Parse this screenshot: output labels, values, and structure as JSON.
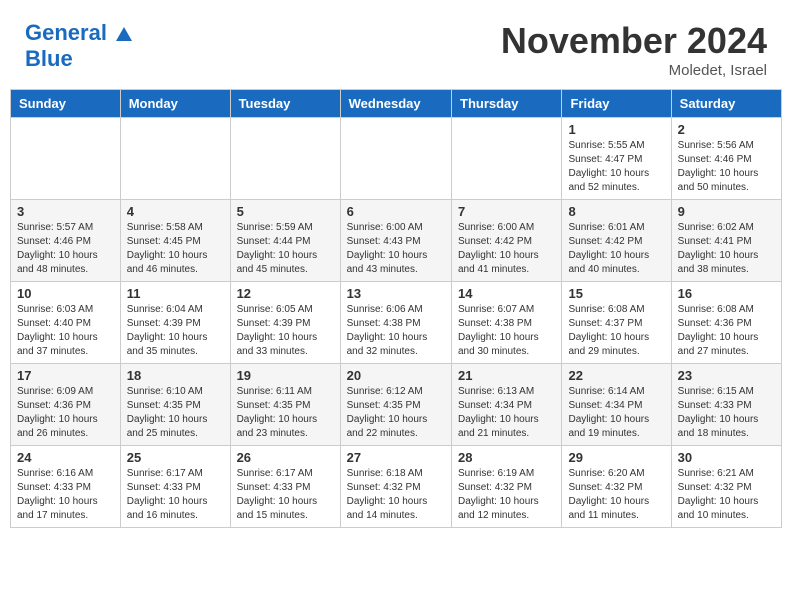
{
  "header": {
    "logo_line1": "General",
    "logo_line2": "Blue",
    "month": "November 2024",
    "location": "Moledet, Israel"
  },
  "weekdays": [
    "Sunday",
    "Monday",
    "Tuesday",
    "Wednesday",
    "Thursday",
    "Friday",
    "Saturday"
  ],
  "rows": [
    [
      {
        "day": "",
        "info": ""
      },
      {
        "day": "",
        "info": ""
      },
      {
        "day": "",
        "info": ""
      },
      {
        "day": "",
        "info": ""
      },
      {
        "day": "",
        "info": ""
      },
      {
        "day": "1",
        "info": "Sunrise: 5:55 AM\nSunset: 4:47 PM\nDaylight: 10 hours and 52 minutes."
      },
      {
        "day": "2",
        "info": "Sunrise: 5:56 AM\nSunset: 4:46 PM\nDaylight: 10 hours and 50 minutes."
      }
    ],
    [
      {
        "day": "3",
        "info": "Sunrise: 5:57 AM\nSunset: 4:46 PM\nDaylight: 10 hours and 48 minutes."
      },
      {
        "day": "4",
        "info": "Sunrise: 5:58 AM\nSunset: 4:45 PM\nDaylight: 10 hours and 46 minutes."
      },
      {
        "day": "5",
        "info": "Sunrise: 5:59 AM\nSunset: 4:44 PM\nDaylight: 10 hours and 45 minutes."
      },
      {
        "day": "6",
        "info": "Sunrise: 6:00 AM\nSunset: 4:43 PM\nDaylight: 10 hours and 43 minutes."
      },
      {
        "day": "7",
        "info": "Sunrise: 6:00 AM\nSunset: 4:42 PM\nDaylight: 10 hours and 41 minutes."
      },
      {
        "day": "8",
        "info": "Sunrise: 6:01 AM\nSunset: 4:42 PM\nDaylight: 10 hours and 40 minutes."
      },
      {
        "day": "9",
        "info": "Sunrise: 6:02 AM\nSunset: 4:41 PM\nDaylight: 10 hours and 38 minutes."
      }
    ],
    [
      {
        "day": "10",
        "info": "Sunrise: 6:03 AM\nSunset: 4:40 PM\nDaylight: 10 hours and 37 minutes."
      },
      {
        "day": "11",
        "info": "Sunrise: 6:04 AM\nSunset: 4:39 PM\nDaylight: 10 hours and 35 minutes."
      },
      {
        "day": "12",
        "info": "Sunrise: 6:05 AM\nSunset: 4:39 PM\nDaylight: 10 hours and 33 minutes."
      },
      {
        "day": "13",
        "info": "Sunrise: 6:06 AM\nSunset: 4:38 PM\nDaylight: 10 hours and 32 minutes."
      },
      {
        "day": "14",
        "info": "Sunrise: 6:07 AM\nSunset: 4:38 PM\nDaylight: 10 hours and 30 minutes."
      },
      {
        "day": "15",
        "info": "Sunrise: 6:08 AM\nSunset: 4:37 PM\nDaylight: 10 hours and 29 minutes."
      },
      {
        "day": "16",
        "info": "Sunrise: 6:08 AM\nSunset: 4:36 PM\nDaylight: 10 hours and 27 minutes."
      }
    ],
    [
      {
        "day": "17",
        "info": "Sunrise: 6:09 AM\nSunset: 4:36 PM\nDaylight: 10 hours and 26 minutes."
      },
      {
        "day": "18",
        "info": "Sunrise: 6:10 AM\nSunset: 4:35 PM\nDaylight: 10 hours and 25 minutes."
      },
      {
        "day": "19",
        "info": "Sunrise: 6:11 AM\nSunset: 4:35 PM\nDaylight: 10 hours and 23 minutes."
      },
      {
        "day": "20",
        "info": "Sunrise: 6:12 AM\nSunset: 4:35 PM\nDaylight: 10 hours and 22 minutes."
      },
      {
        "day": "21",
        "info": "Sunrise: 6:13 AM\nSunset: 4:34 PM\nDaylight: 10 hours and 21 minutes."
      },
      {
        "day": "22",
        "info": "Sunrise: 6:14 AM\nSunset: 4:34 PM\nDaylight: 10 hours and 19 minutes."
      },
      {
        "day": "23",
        "info": "Sunrise: 6:15 AM\nSunset: 4:33 PM\nDaylight: 10 hours and 18 minutes."
      }
    ],
    [
      {
        "day": "24",
        "info": "Sunrise: 6:16 AM\nSunset: 4:33 PM\nDaylight: 10 hours and 17 minutes."
      },
      {
        "day": "25",
        "info": "Sunrise: 6:17 AM\nSunset: 4:33 PM\nDaylight: 10 hours and 16 minutes."
      },
      {
        "day": "26",
        "info": "Sunrise: 6:17 AM\nSunset: 4:33 PM\nDaylight: 10 hours and 15 minutes."
      },
      {
        "day": "27",
        "info": "Sunrise: 6:18 AM\nSunset: 4:32 PM\nDaylight: 10 hours and 14 minutes."
      },
      {
        "day": "28",
        "info": "Sunrise: 6:19 AM\nSunset: 4:32 PM\nDaylight: 10 hours and 12 minutes."
      },
      {
        "day": "29",
        "info": "Sunrise: 6:20 AM\nSunset: 4:32 PM\nDaylight: 10 hours and 11 minutes."
      },
      {
        "day": "30",
        "info": "Sunrise: 6:21 AM\nSunset: 4:32 PM\nDaylight: 10 hours and 10 minutes."
      }
    ]
  ]
}
